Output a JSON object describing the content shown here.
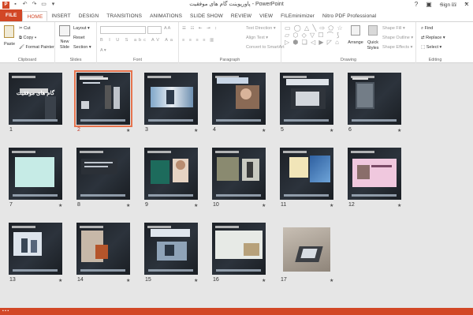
{
  "window": {
    "title": "پاورپوینت گام های موفقیت - PowerPoint"
  },
  "qat": {
    "save": "save-icon",
    "undo": "undo-icon",
    "redo": "redo-icon",
    "start": "start-slideshow-icon"
  },
  "tabs": [
    "FILE",
    "HOME",
    "INSERT",
    "DESIGN",
    "TRANSITIONS",
    "ANIMATIONS",
    "SLIDE SHOW",
    "REVIEW",
    "VIEW",
    "FILEminimizer",
    "Nitro PDF Professional"
  ],
  "account": {
    "sign_in": "Sign in"
  },
  "ribbon": {
    "clipboard": {
      "label": "Clipboard",
      "paste": "Paste",
      "cut": "Cut",
      "copy": "Copy",
      "format_painter": "Format Painter"
    },
    "slides": {
      "label": "Slides",
      "new_slide": "New Slide",
      "layout": "Layout",
      "reset": "Reset",
      "section": "Section"
    },
    "font": {
      "label": "Font"
    },
    "paragraph": {
      "label": "Paragraph",
      "text_direction": "Text Direction",
      "align_text": "Align Text",
      "convert": "Convert to SmartArt"
    },
    "drawing": {
      "label": "Drawing",
      "arrange": "Arrange",
      "quick_styles": "Quick Styles",
      "shape_fill": "Shape Fill",
      "shape_outline": "Shape Outline",
      "shape_effects": "Shape Effects"
    },
    "editing": {
      "label": "Editing",
      "find": "Find",
      "replace": "Replace",
      "select": "Select"
    }
  },
  "slides": [
    {
      "n": "1",
      "title": "گام های موفقیت",
      "star": ""
    },
    {
      "n": "2",
      "star": "★"
    },
    {
      "n": "3",
      "star": "★"
    },
    {
      "n": "4",
      "star": "★"
    },
    {
      "n": "5",
      "star": "★"
    },
    {
      "n": "6",
      "star": "★"
    },
    {
      "n": "7",
      "star": "★"
    },
    {
      "n": "8",
      "star": "★"
    },
    {
      "n": "9",
      "star": "★"
    },
    {
      "n": "10",
      "star": "★"
    },
    {
      "n": "11",
      "star": "★"
    },
    {
      "n": "12",
      "star": "★"
    },
    {
      "n": "13",
      "star": "★"
    },
    {
      "n": "14",
      "star": "★"
    },
    {
      "n": "15",
      "star": "★"
    },
    {
      "n": "16",
      "star": "★"
    },
    {
      "n": "17",
      "star": "★"
    }
  ],
  "colors": {
    "accent": "#d24726",
    "selection": "#e6734d"
  }
}
